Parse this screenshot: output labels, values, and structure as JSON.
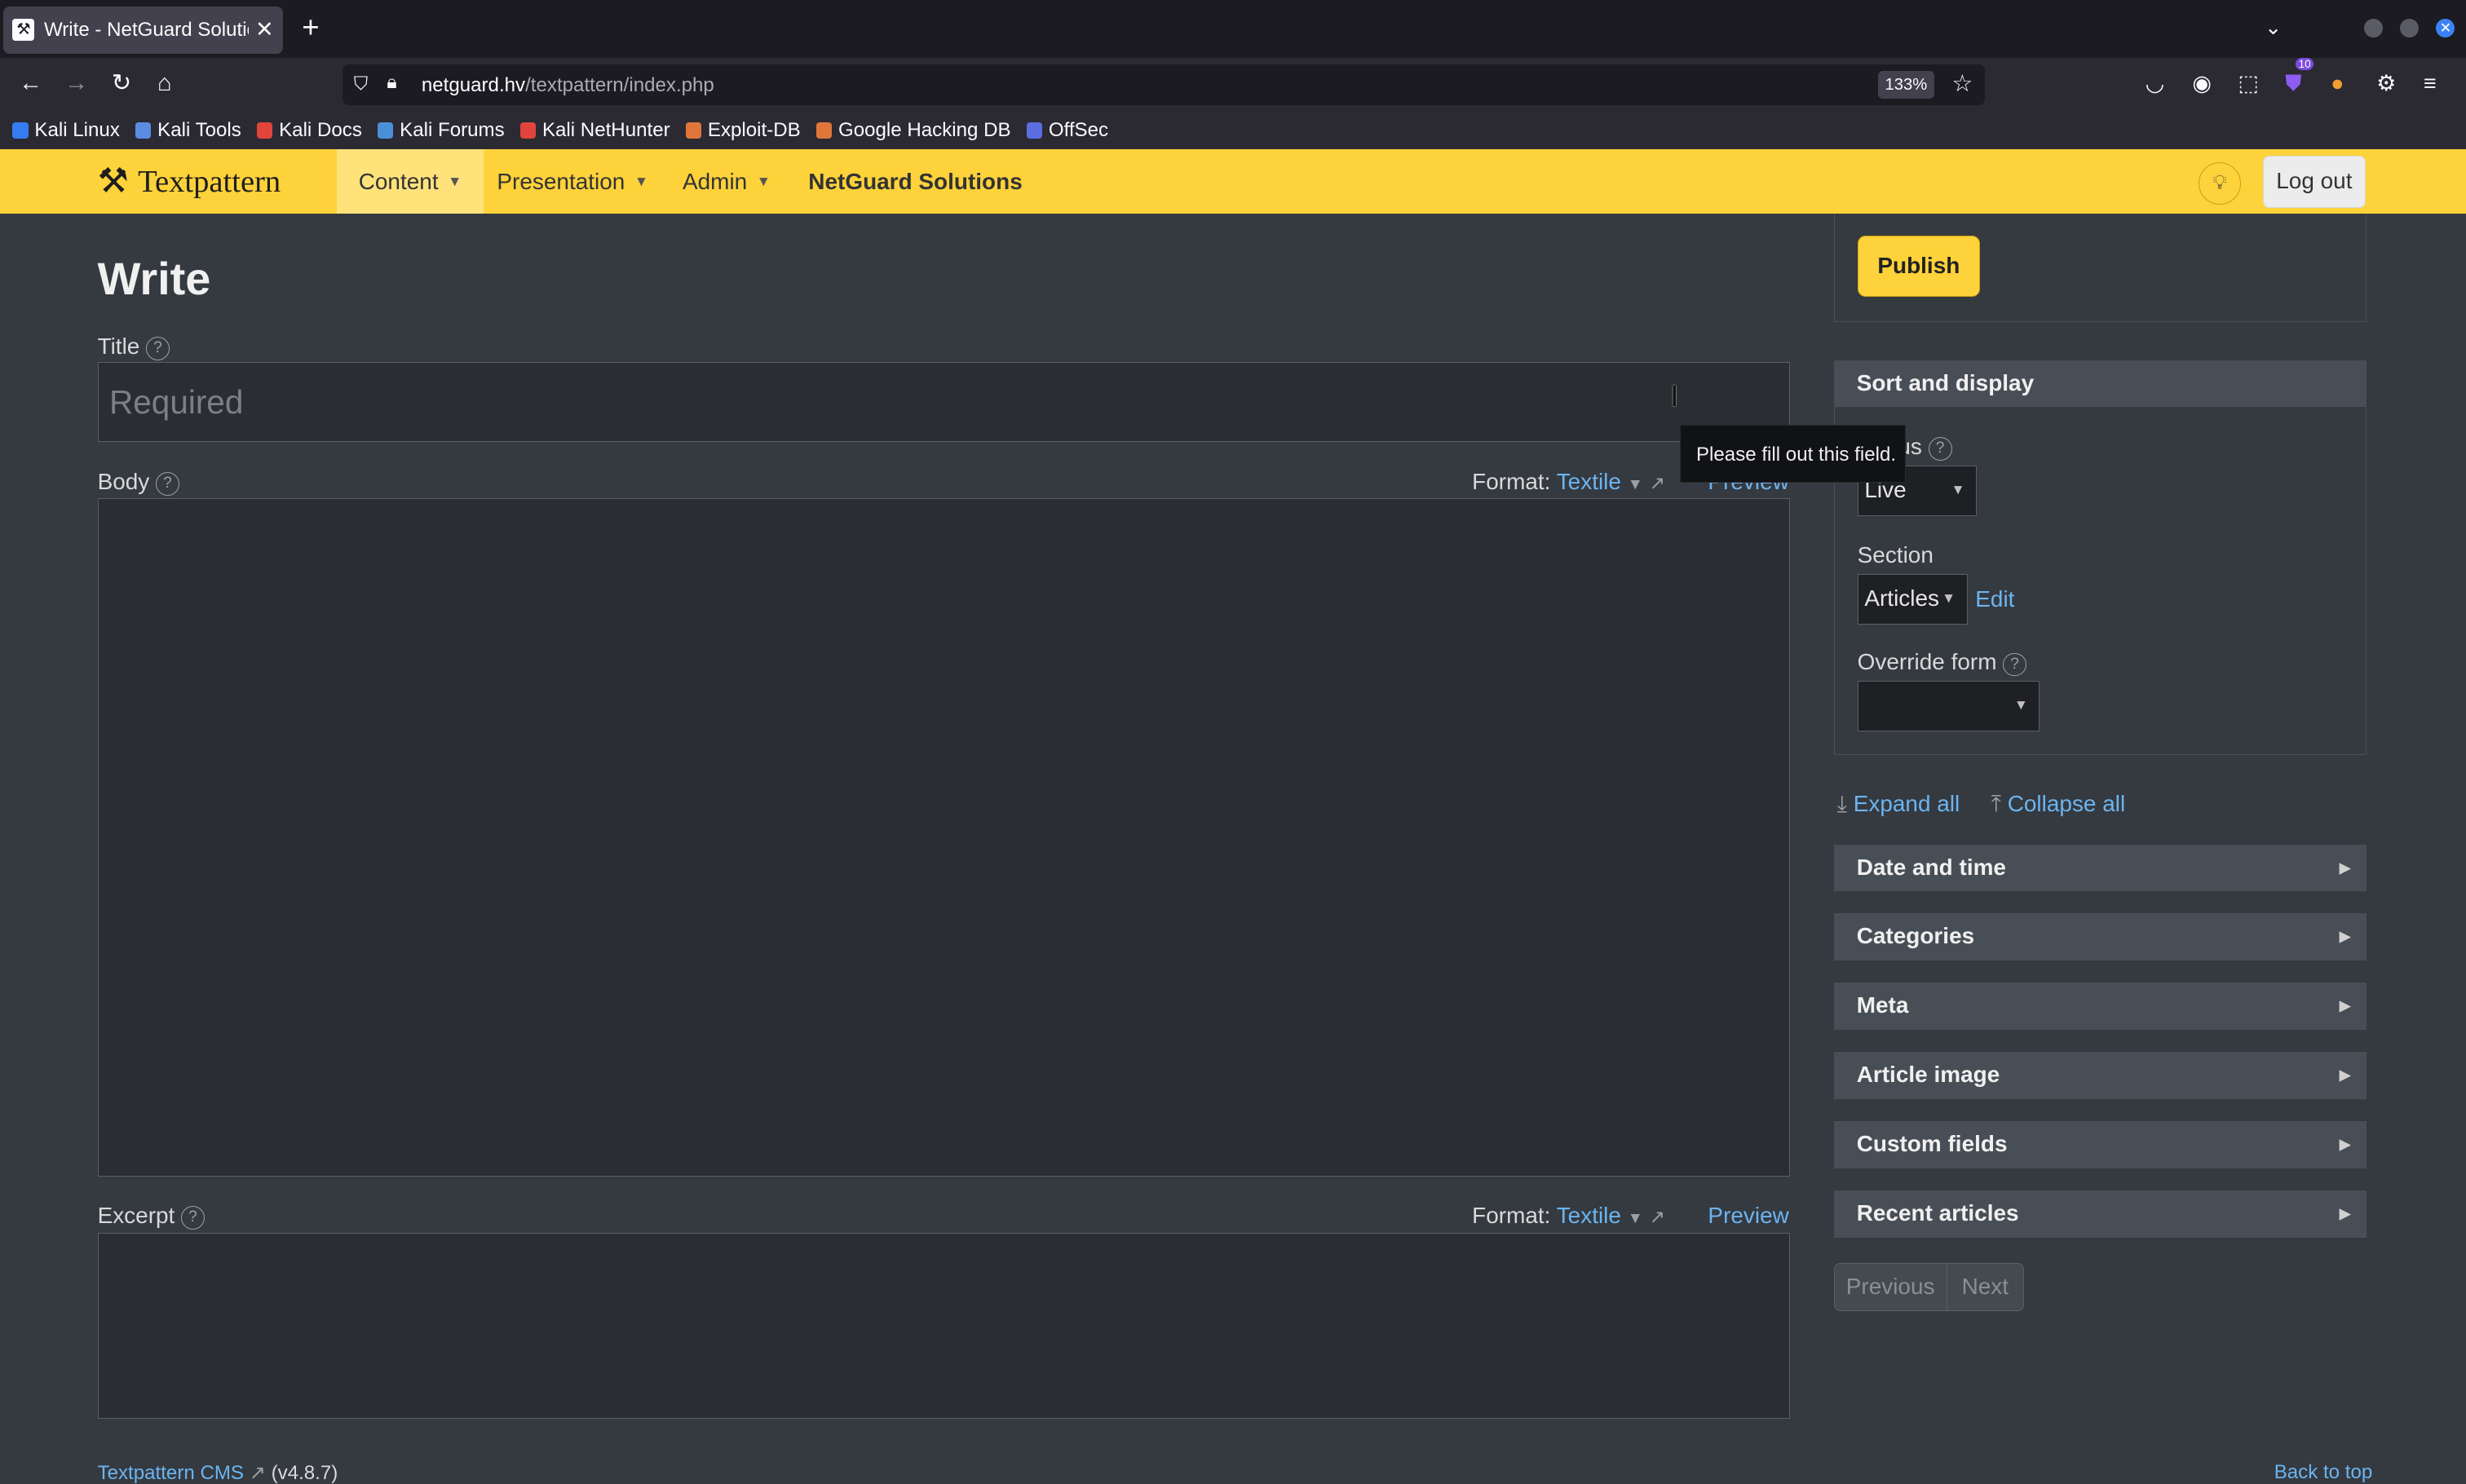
{
  "browser": {
    "tab_title": "Write - NetGuard Solutions",
    "url_host": "netguard.hv",
    "url_path": "/textpattern/index.php",
    "zoom": "133%",
    "extension_badge": "10",
    "bookmarks": [
      {
        "label": "Kali Linux",
        "color": "#367bf0"
      },
      {
        "label": "Kali Tools",
        "color": "#5a8de0"
      },
      {
        "label": "Kali Docs",
        "color": "#e0443a"
      },
      {
        "label": "Kali Forums",
        "color": "#4a90d9"
      },
      {
        "label": "Kali NetHunter",
        "color": "#e0443a"
      },
      {
        "label": "Exploit-DB",
        "color": "#e0763a"
      },
      {
        "label": "Google Hacking DB",
        "color": "#e0763a"
      },
      {
        "label": "OffSec",
        "color": "#5b6ee0"
      }
    ]
  },
  "header": {
    "brand": "Textpattern",
    "menu": {
      "content": "Content",
      "presentation": "Presentation",
      "admin": "Admin"
    },
    "site_name": "NetGuard Solutions",
    "logout": "Log out"
  },
  "main": {
    "heading": "Write",
    "title_label": "Title",
    "title_placeholder": "Required",
    "body_label": "Body",
    "excerpt_label": "Excerpt",
    "format_label": "Format:",
    "format_value": "Textile",
    "preview": "Preview",
    "tooltip": "Please fill out this field."
  },
  "sidebar": {
    "publish": "Publish",
    "sort_display": "Sort and display",
    "status_label": "Status",
    "status_value": "Live",
    "section_label": "Section",
    "section_value": "Articles",
    "section_edit": "Edit",
    "override_label": "Override form",
    "override_value": "",
    "expand_all": "Expand all",
    "collapse_all": "Collapse all",
    "panels": {
      "p0": "Date and time",
      "p1": "Categories",
      "p2": "Meta",
      "p3": "Article image",
      "p4": "Custom fields",
      "p5": "Recent articles"
    },
    "previous": "Previous",
    "next": "Next"
  },
  "footer": {
    "cms_link": "Textpattern CMS",
    "version": "(v4.8.7)",
    "back_to_top": "Back to top"
  },
  "colors": {
    "accent": "#fed23a",
    "link": "#6cb4f0",
    "page_bg": "#353a40"
  }
}
